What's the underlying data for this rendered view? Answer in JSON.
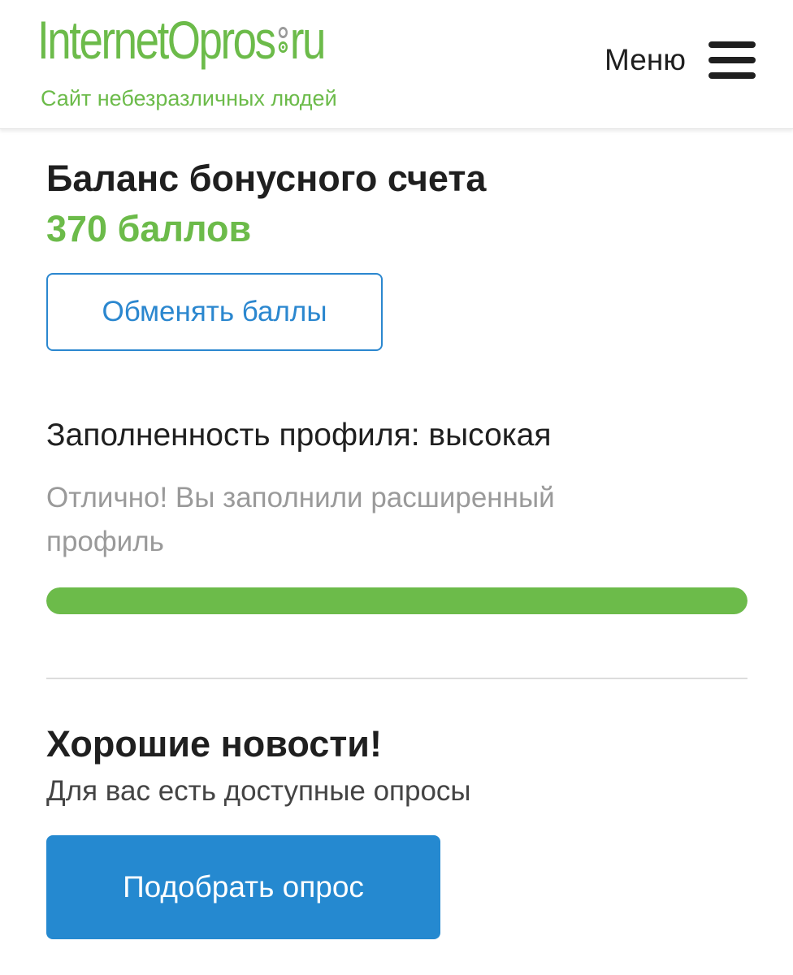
{
  "header": {
    "logo": {
      "part1": "InternetOpros",
      "part2": "ru"
    },
    "tagline": "Сайт небезразличных людей",
    "menu_label": "Меню",
    "menu_icon": "hamburger-icon"
  },
  "balance": {
    "title": "Баланс бонусного счета",
    "value": "370 баллов",
    "exchange_button": "Обменять баллы"
  },
  "profile": {
    "title": "Заполненность профиля: высокая",
    "note": "Отлично! Вы заполнили расширенный профиль",
    "progress": 1.0
  },
  "news": {
    "title": "Хорошие новости!",
    "subtitle": "Для вас есть доступные опросы",
    "pick_button": "Подобрать опрос"
  },
  "colors": {
    "brand_green": "#6cbb4a",
    "accent_blue": "#2589d0",
    "muted_text": "#9a9a9a"
  }
}
